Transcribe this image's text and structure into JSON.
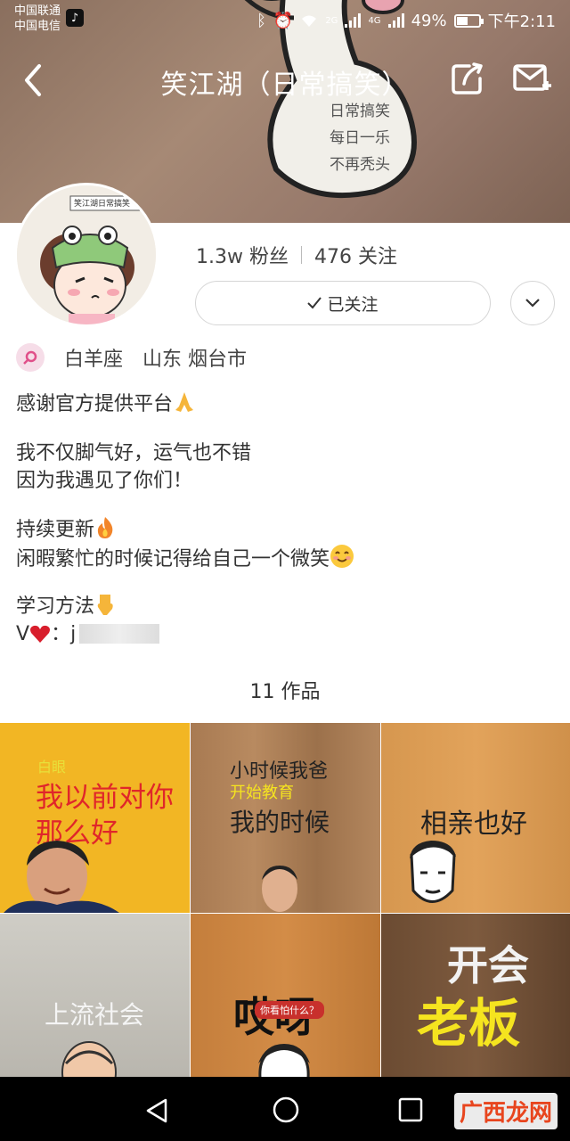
{
  "status_bar": {
    "carrier_1": "中国联通",
    "carrier_2": "中国电信",
    "net_1": "2G",
    "net_2": "4G",
    "battery": "49%",
    "time": "下午2:11"
  },
  "nav": {
    "title": "笑江湖（日常搞笑）"
  },
  "banner": {
    "art_lines": [
      "日常搞笑",
      "每日一乐",
      "不再秃头"
    ]
  },
  "avatar": {
    "caption": "笑江湖日常搞笑"
  },
  "stats": {
    "fans": "1.3w 粉丝",
    "following": "476 关注"
  },
  "follow_button": {
    "label": "已关注"
  },
  "profile": {
    "zodiac": "白羊座",
    "location": "山东 烟台市"
  },
  "bio": {
    "line1": "感谢官方提供平台",
    "line2": "我不仅脚气好，运气也不错",
    "line3": "因为我遇见了你们！",
    "line4": "持续更新",
    "line5": "闲暇繁忙的时候记得给自己一个微笑",
    "line6": "学习方法",
    "line7_prefix": "V",
    "line7_rest": "：j"
  },
  "works": {
    "count": "11 作品"
  },
  "tiles": [
    {
      "tag": "白眼",
      "line1": "我以前对你",
      "line2": "那么好"
    },
    {
      "line1": "小时候我爸",
      "line2": "开始教育",
      "line3": "我的时候"
    },
    {
      "line1": "相亲也好"
    },
    {
      "line1": "上流社会"
    },
    {
      "line1": "哎呀",
      "bubble": "你看怕什么？"
    },
    {
      "line1": "开会",
      "line2": "老板"
    }
  ],
  "watermark": "广西龙网",
  "colors": {
    "banner": "#a68975",
    "yellow_tile": "#f2b624",
    "tile_red_text": "#e0262a",
    "tile_yellow_text": "#f5e41f"
  }
}
